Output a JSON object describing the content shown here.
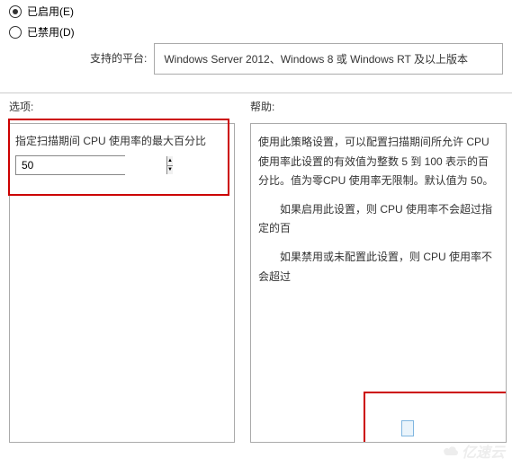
{
  "radios": {
    "enabled": "已启用(E)",
    "disabled": "已禁用(D)"
  },
  "platforms": {
    "label": "支持的平台:",
    "value": "Windows Server 2012、Windows 8 或 Windows RT 及以上版本"
  },
  "sections": {
    "options": "选项:",
    "help": "帮助:"
  },
  "option": {
    "cpu_label": "指定扫描期间 CPU 使用率的最大百分比",
    "cpu_value": "50"
  },
  "help": {
    "p1": "使用此策略设置，可以配置扫描期间所允许 CPU 使用率此设置的有效值为整数 5 到 100 表示的百分比。值为零CPU 使用率无限制。默认值为 50。",
    "p2": "如果启用此设置，则 CPU 使用率不会超过指定的百",
    "p3": "如果禁用或未配置此设置，则 CPU 使用率不会超过"
  },
  "watermark": "亿速云"
}
